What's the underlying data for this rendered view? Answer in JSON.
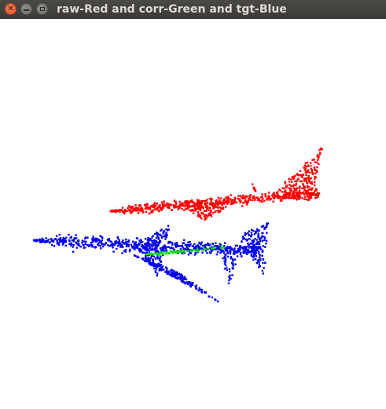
{
  "window": {
    "title": "raw-Red and corr-Green and tgt-Blue",
    "controls": {
      "close_icon": "close-icon",
      "minimize_icon": "minimize-icon",
      "maximize_icon": "maximize-icon"
    }
  },
  "colors": {
    "raw": "#ff0000",
    "corr": "#00e000",
    "tgt": "#0000ee",
    "background": "#ffffff"
  }
}
